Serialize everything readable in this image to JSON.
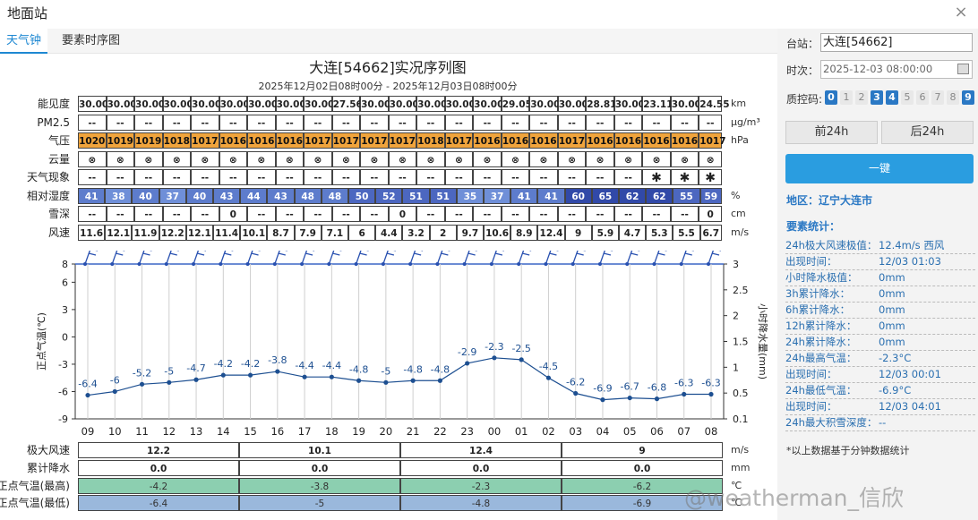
{
  "window": {
    "title": "地面站",
    "close_label": "×"
  },
  "tabs": [
    {
      "label": "天气钟"
    },
    {
      "label": "要素时序图"
    }
  ],
  "chart_title": "大连[54662]实况序列图",
  "chart_subtitle": "2025年12月02日08时00分 - 2025年12月03日08时00分",
  "table": {
    "rows": [
      {
        "label": "能见度",
        "unit": "km",
        "style": "plain",
        "values": [
          "30.00",
          "30.00",
          "30.00",
          "30.00",
          "30.00",
          "30.00",
          "30.00",
          "30.00",
          "30.00",
          "27.56",
          "30.00",
          "30.00",
          "30.00",
          "30.00",
          "30.00",
          "29.05",
          "30.00",
          "30.00",
          "28.81",
          "30.00",
          "23.11",
          "30.00",
          "24.55"
        ]
      },
      {
        "label": "PM2.5",
        "unit": "μg/m³",
        "style": "plain",
        "values": [
          "--",
          "--",
          "--",
          "--",
          "--",
          "--",
          "--",
          "--",
          "--",
          "--",
          "--",
          "--",
          "--",
          "--",
          "--",
          "--",
          "--",
          "--",
          "--",
          "--",
          "--",
          "--",
          "--"
        ]
      },
      {
        "label": "气压",
        "unit": "hPa",
        "style": "orange",
        "values": [
          "1020",
          "1019",
          "1019",
          "1018",
          "1017",
          "1016",
          "1016",
          "1016",
          "1017",
          "1017",
          "1017",
          "1017",
          "1018",
          "1017",
          "1016",
          "1016",
          "1016",
          "1017",
          "1016",
          "1016",
          "1016",
          "1016",
          "1017"
        ]
      },
      {
        "label": "云量",
        "unit": "",
        "style": "plain",
        "values": [
          "⊗",
          "⊗",
          "⊗",
          "⊗",
          "⊗",
          "⊗",
          "⊗",
          "⊗",
          "⊗",
          "⊗",
          "⊗",
          "⊗",
          "⊗",
          "⊗",
          "⊗",
          "⊗",
          "⊗",
          "⊗",
          "⊗",
          "⊗",
          "⊗",
          "⊗",
          "⊗"
        ]
      },
      {
        "label": "天气现象",
        "unit": "",
        "style": "plain",
        "values": [
          "--",
          "--",
          "--",
          "--",
          "--",
          "--",
          "--",
          "--",
          "--",
          "--",
          "--",
          "--",
          "--",
          "--",
          "--",
          "--",
          "--",
          "--",
          "--",
          "--",
          "✱",
          "✱",
          "✱"
        ]
      },
      {
        "label": "相对湿度",
        "unit": "%",
        "style": "humid",
        "values": [
          "41",
          "38",
          "40",
          "37",
          "40",
          "43",
          "44",
          "43",
          "48",
          "48",
          "50",
          "52",
          "51",
          "51",
          "35",
          "37",
          "41",
          "41",
          "60",
          "65",
          "62",
          "62",
          "55",
          "59"
        ]
      },
      {
        "label": "雪深",
        "unit": "cm",
        "style": "plain",
        "values": [
          "--",
          "--",
          "--",
          "--",
          "--",
          "0",
          "--",
          "--",
          "--",
          "--",
          "--",
          "0",
          "--",
          "--",
          "--",
          "--",
          "--",
          "--",
          "--",
          "--",
          "--",
          "--",
          "0"
        ]
      },
      {
        "label": "风速",
        "unit": "m/s",
        "style": "plain",
        "values": [
          "11.6",
          "12.1",
          "11.9",
          "12.2",
          "12.1",
          "11.4",
          "10.1",
          "8.7",
          "7.9",
          "7.1",
          "6",
          "4.4",
          "3.2",
          "2",
          "9.7",
          "10.6",
          "8.9",
          "12.4",
          "9",
          "5.9",
          "4.7",
          "5.3",
          "5.5",
          "6.7"
        ]
      }
    ]
  },
  "chart_data": {
    "type": "line",
    "x": [
      "09",
      "10",
      "11",
      "12",
      "13",
      "14",
      "15",
      "16",
      "17",
      "18",
      "19",
      "20",
      "21",
      "22",
      "23",
      "00",
      "01",
      "02",
      "03",
      "04",
      "05",
      "06",
      "07",
      "08"
    ],
    "series": [
      {
        "values": [
          -6.4,
          -6,
          -5.2,
          -5,
          -4.7,
          -4.2,
          -4.2,
          -3.8,
          -4.4,
          -4.4,
          -4.8,
          -5,
          -4.8,
          -4.8,
          -2.9,
          -2.3,
          -2.5,
          -4.5,
          -6.2,
          -6.9,
          -6.7,
          -6.8,
          -6.3,
          -6.3
        ],
        "color": "#1d4f91"
      }
    ],
    "ylabel_left": "正点气温(℃)",
    "ylabel_right": "小时降水量(mm)",
    "yticks_left": [
      "8",
      "6",
      "3",
      "0",
      "-3",
      "-6",
      "-9"
    ],
    "yticks_right": [
      "3",
      "2.5",
      "2",
      "1.5",
      "1",
      "0.5",
      "0.1"
    ],
    "ylim_left": [
      -9,
      8
    ],
    "grid": true
  },
  "summary": {
    "rows": [
      {
        "label": "极大风速",
        "unit": "m/s",
        "style": "plain",
        "values": [
          "12.2",
          "10.1",
          "12.4",
          "9"
        ]
      },
      {
        "label": "累计降水",
        "unit": "mm",
        "style": "plain",
        "values": [
          "0.0",
          "0.0",
          "0.0",
          "0.0"
        ]
      },
      {
        "label": "正点气温(最高)",
        "unit": "℃",
        "style": "green",
        "values": [
          "-4.2",
          "-3.8",
          "-2.3",
          "-6.2"
        ]
      },
      {
        "label": "正点气温(最低)",
        "unit": "℃",
        "style": "blue",
        "values": [
          "-6.4",
          "-5",
          "-4.8",
          "-6.9"
        ]
      }
    ]
  },
  "side": {
    "station_label": "台站：",
    "station_value": "大连[54662]",
    "time_label": "时次：",
    "time_value": "2025-12-03 08:00:00",
    "qc_label": "质控码:",
    "qc_codes": [
      {
        "code": "0",
        "on": true
      },
      {
        "code": "1",
        "on": false
      },
      {
        "code": "2",
        "on": false
      },
      {
        "code": "3",
        "on": true
      },
      {
        "code": "4",
        "on": true
      },
      {
        "code": "5",
        "on": false
      },
      {
        "code": "6",
        "on": false
      },
      {
        "code": "7",
        "on": false
      },
      {
        "code": "8",
        "on": false
      },
      {
        "code": "9",
        "on": true
      }
    ],
    "prev_label": "前24h",
    "next_label": "后24h",
    "query_label": "一键",
    "region_label": "地区：辽宁大连市",
    "stats_title": "要素统计：",
    "stats": [
      {
        "key": "24h极大风速极值：",
        "val": "12.4m/s 西风"
      },
      {
        "key": "出现时间：",
        "val": "12/03 01:03"
      },
      {
        "key": "小时降水极值：",
        "val": "0mm"
      },
      {
        "key": "3h累计降水：",
        "val": "0mm"
      },
      {
        "key": "6h累计降水：",
        "val": "0mm"
      },
      {
        "key": "12h累计降水：",
        "val": "0mm"
      },
      {
        "key": "24h累计降水：",
        "val": "0mm"
      },
      {
        "key": "24h最高气温：",
        "val": "-2.3°C"
      },
      {
        "key": "出现时间：",
        "val": "12/03 00:01"
      },
      {
        "key": "24h最低气温：",
        "val": "-6.9°C"
      },
      {
        "key": "出现时间：",
        "val": "12/03 04:01"
      },
      {
        "key": "24h最大积雪深度：",
        "val": "--"
      }
    ],
    "note": "*以上数据基于分钟数据统计"
  },
  "watermark": "@weatherman_信欣"
}
